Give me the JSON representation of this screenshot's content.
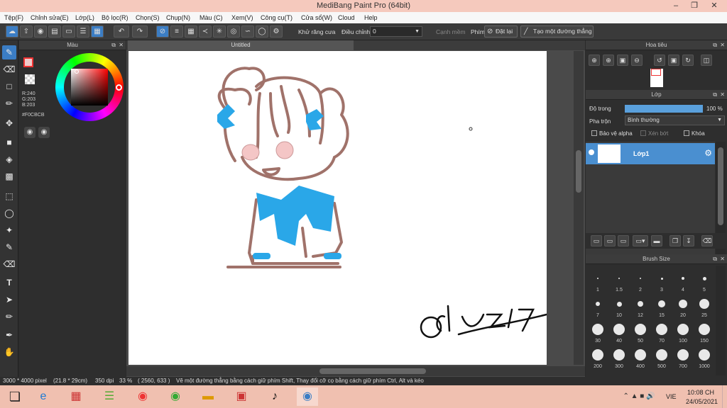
{
  "window": {
    "title": "MediBang Paint Pro (64bit)"
  },
  "menu": [
    "Tệp(F)",
    "Chỉnh sửa(E)",
    "Lớp(L)",
    "Bộ lọc(R)",
    "Chọn(S)",
    "Chụp(N)",
    "Màu (C)",
    "Xem(V)",
    "Công cụ(T)",
    "Cửa sổ(W)",
    "Cloud",
    "Help"
  ],
  "toolbar": {
    "antialias_label": "Khử răng cưa",
    "adjust_label": "Điều chỉnh",
    "adjust_value": "0",
    "edge_label": "Cạnh mềm",
    "key_label": "Phím",
    "reset_label": "Đặt lại",
    "line_label": "Tạo một đường thẳng"
  },
  "color_panel": {
    "title": "Màu",
    "r": "R:240",
    "g": "G:203",
    "b": "B:203",
    "hex": "#F0CBCB",
    "primary_color": "#F0CBCB",
    "secondary_color": "#FFFFFF"
  },
  "document": {
    "tab": "Untitled"
  },
  "navigator": {
    "title": "Hoa tiêu"
  },
  "layer_panel": {
    "title": "Lớp",
    "opacity_label": "Độ trong",
    "opacity_value": "100 %",
    "opacity_fraction": 1.0,
    "blend_label": "Pha trộn",
    "blend_value": "Bình thường",
    "protect_alpha": "Bảo vệ alpha",
    "clip": "Xén bớt",
    "lock": "Khóa",
    "layer_name": "Lớp1"
  },
  "brush_size": {
    "title": "Brush Size",
    "sizes": [
      "1",
      "1.5",
      "2",
      "3",
      "4",
      "5",
      "7",
      "10",
      "12",
      "15",
      "20",
      "25",
      "30",
      "40",
      "50",
      "70",
      "100",
      "150",
      "200",
      "300",
      "400",
      "500",
      "700",
      "1000"
    ]
  },
  "status": {
    "size": "3000 * 4000 pixel",
    "cm": "(21.8 * 29cm)",
    "dpi": "350 dpi",
    "zoom": "33 %",
    "coords": "( 2560, 633 )",
    "hint": "Vẽ một đường thẳng bằng cách giữ phím Shift, Thay đổi cỡ cọ bằng cách giữ phím Ctrl, Alt và kéo"
  },
  "taskbar": {
    "lang": "VIE",
    "time": "10:08 CH",
    "date": "24/05/2021"
  },
  "signature": "@chy2k7",
  "accent": "#3B7DC4"
}
